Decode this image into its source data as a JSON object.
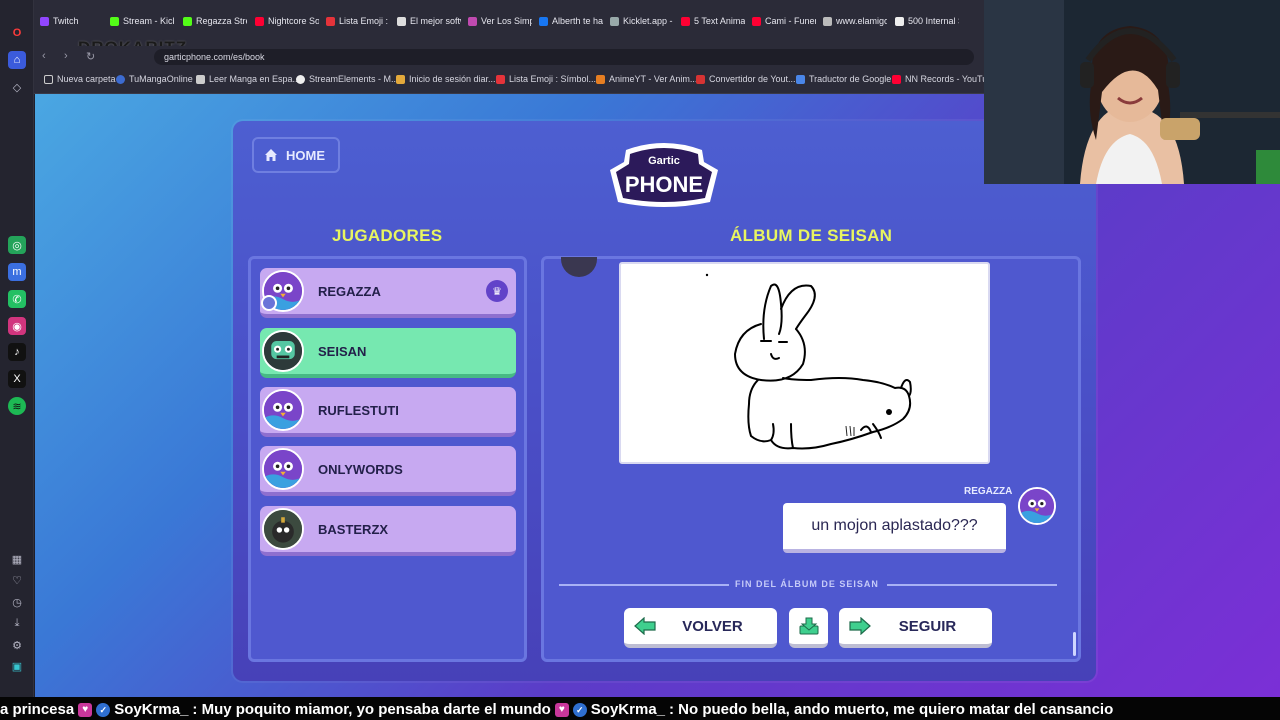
{
  "browser": {
    "tabs": [
      "Twitch",
      "Stream - Kick",
      "Regazza Strea",
      "Nightcore Son",
      "Lista Emoji : S",
      "El mejor softw",
      "Ver Los Simps",
      "Alberth te ha",
      "Kicklet.app - K",
      "5 Text Animati",
      "Cami - Funeral",
      "www.elamigos",
      "500 Internal S"
    ],
    "overlay_name": "DROKARITZ",
    "url": "garticphone.com/es/book",
    "bookmarks": [
      "Nueva carpeta",
      "TuMangaOnline",
      "Leer Manga en Espa...",
      "StreamElements - M...",
      "Inicio de sesión diar...",
      "Lista Emoji : Símbol...",
      "AnimeYT - Ver Anim...",
      "Convertidor de Yout...",
      "Traductor de Google",
      "NN Records - YouTu..."
    ]
  },
  "game": {
    "home_label": "HOME",
    "logo_top": "Gartic",
    "logo_main": "PHONE",
    "players_title": "JUGADORES",
    "album_title": "ÁLBUM DE SEISAN",
    "players": [
      {
        "name": "REGAZZA",
        "active": false,
        "host": true
      },
      {
        "name": "SEISAN",
        "active": true,
        "host": false
      },
      {
        "name": "RUFLESTUTI",
        "active": false,
        "host": false
      },
      {
        "name": "ONLYWORDS",
        "active": false,
        "host": false
      },
      {
        "name": "BASTERZX",
        "active": false,
        "host": false
      }
    ],
    "guess_author": "REGAZZA",
    "guess_text": "un mojon aplastado???",
    "end_text": "FIN DEL ÁLBUM DE SEISAN",
    "back_label": "VOLVER",
    "next_label": "SEGUIR"
  },
  "ticker": {
    "part0": "a princesa",
    "user1": "SoyKrma_",
    "msg1": ": Muy poquito miamor, yo pensaba darte el mundo",
    "user2": "SoyKrma_",
    "msg2": ": No puedo bella, ando muerto, me quiero matar del cansancio"
  },
  "colors": {
    "accent_yellow": "#e8f560",
    "active_player": "#76e8b0",
    "player_bg": "#c7a9f1",
    "arrow_green": "#3fcf8e"
  }
}
